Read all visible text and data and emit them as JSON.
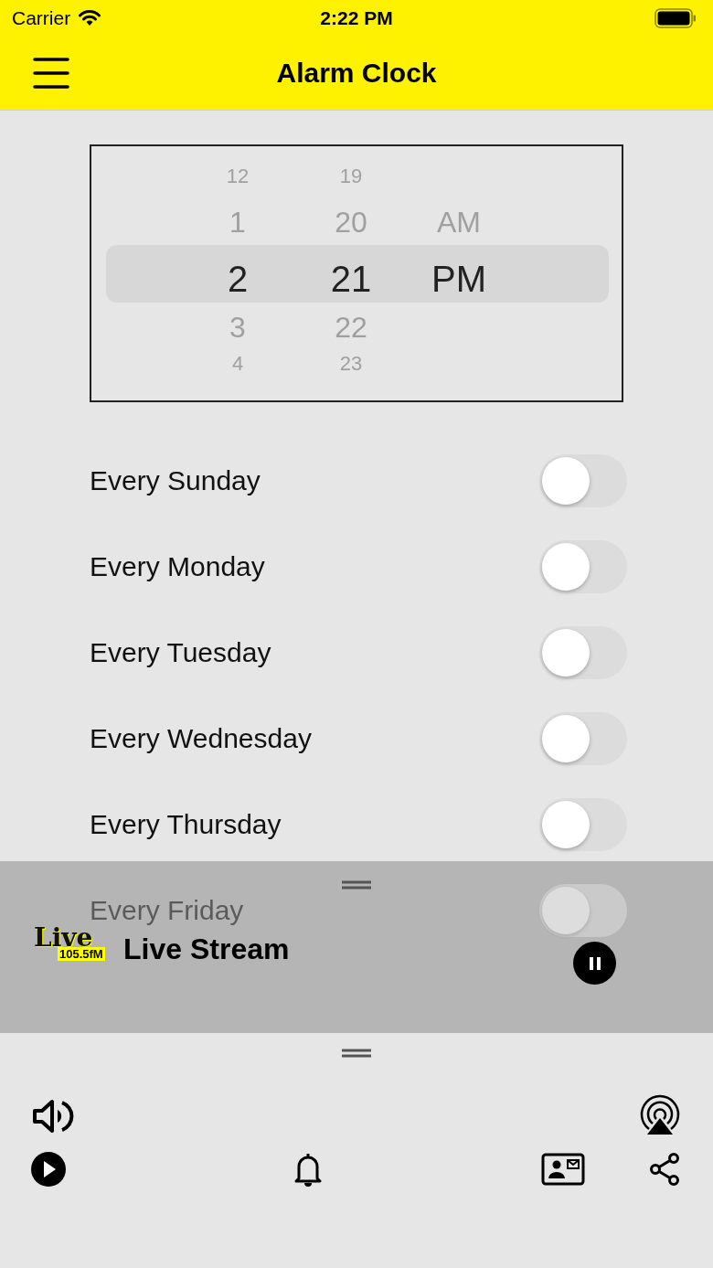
{
  "status_bar": {
    "carrier": "Carrier",
    "time": "2:22 PM"
  },
  "nav": {
    "title": "Alarm Clock"
  },
  "picker": {
    "columns": [
      {
        "kind": "hour",
        "items": [
          {
            "label": "12",
            "selected": false
          },
          {
            "label": "1",
            "selected": false
          },
          {
            "label": "2",
            "selected": true
          },
          {
            "label": "3",
            "selected": false
          },
          {
            "label": "4",
            "selected": false
          }
        ]
      },
      {
        "kind": "minute",
        "items": [
          {
            "label": "19",
            "selected": false
          },
          {
            "label": "20",
            "selected": false
          },
          {
            "label": "21",
            "selected": true
          },
          {
            "label": "22",
            "selected": false
          },
          {
            "label": "23",
            "selected": false
          }
        ]
      },
      {
        "kind": "period",
        "items": [
          {
            "label": "AM",
            "selected": false
          },
          {
            "label": "PM",
            "selected": true
          }
        ]
      }
    ]
  },
  "repeat_days": [
    {
      "label": "Every Sunday",
      "on": false
    },
    {
      "label": "Every Monday",
      "on": false
    },
    {
      "label": "Every Tuesday",
      "on": false
    },
    {
      "label": "Every Wednesday",
      "on": false
    },
    {
      "label": "Every Thursday",
      "on": false
    },
    {
      "label": "Every Friday",
      "on": false
    }
  ],
  "now_playing": {
    "title": "Live Stream",
    "logo": {
      "word": "Live",
      "frequency": "105.5fM"
    },
    "playing": true
  }
}
